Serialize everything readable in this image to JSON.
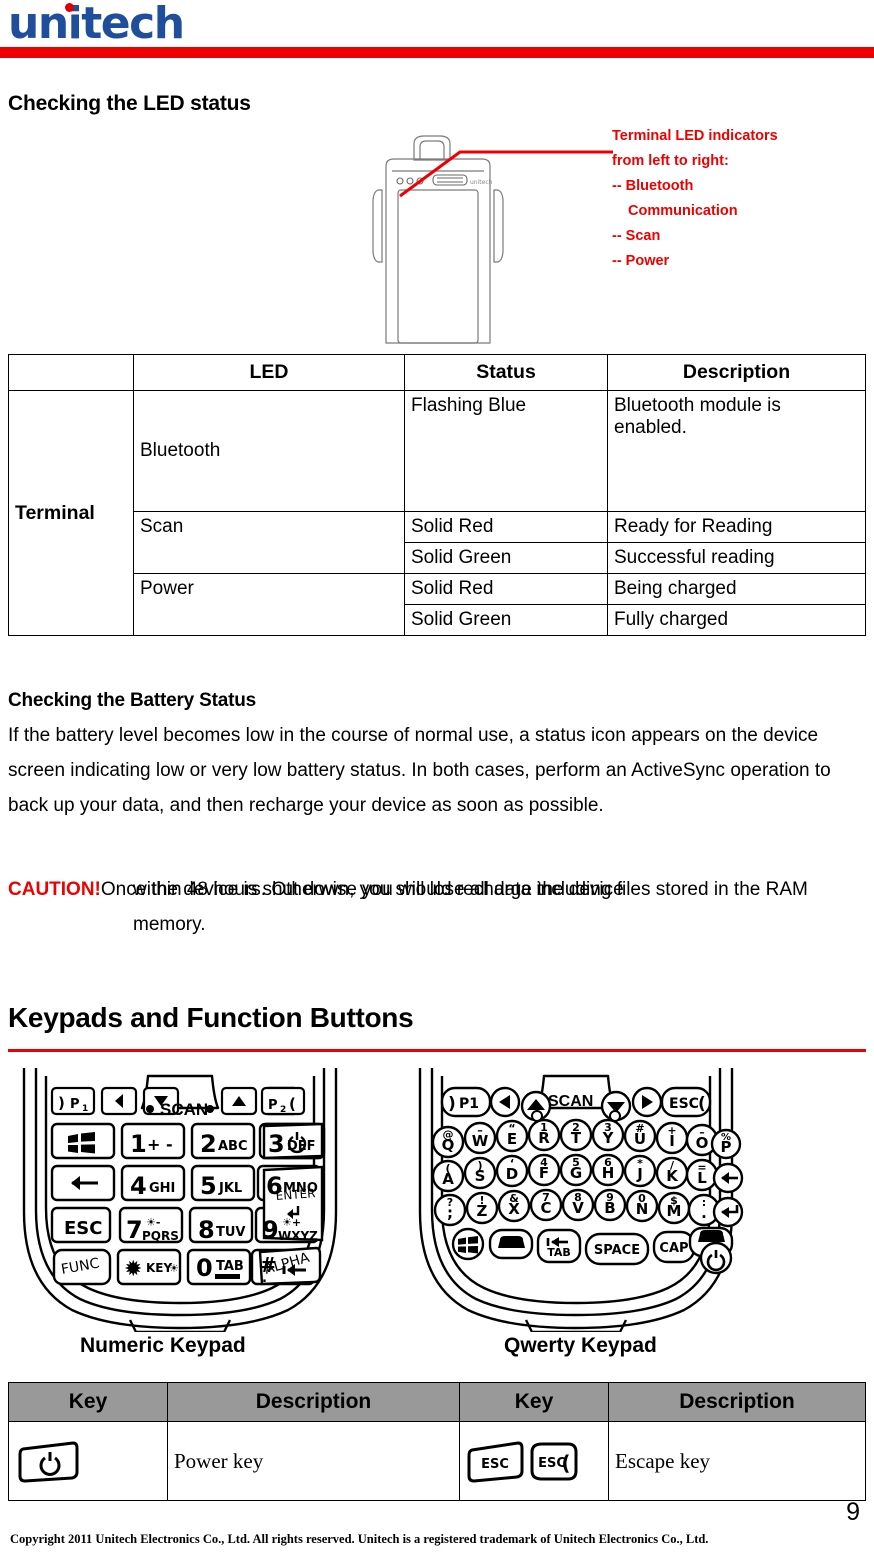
{
  "brand": {
    "logo_text": "unitech",
    "logo_color": "#1f4e9c",
    "accent_color": "#ee0000"
  },
  "headings": {
    "led_status": "Checking the LED status",
    "battery_status": "Checking the Battery Status",
    "keypads": "Keypads and Function Buttons"
  },
  "callout": {
    "line1": "Terminal LED indicators",
    "line2": "from left to right:",
    "line3": "-- Bluetooth",
    "line4": "Communication",
    "line5": "-- Scan",
    "line6": "-- Power"
  },
  "led_table": {
    "headers": [
      "",
      "LED",
      "Status",
      "Description"
    ],
    "group_label": "Terminal",
    "rows": [
      {
        "led": "Bluetooth",
        "status": "Flashing Blue",
        "description": "Bluetooth module is enabled."
      },
      {
        "led": "Scan",
        "status": "Solid Red",
        "description": "Ready for Reading"
      },
      {
        "led": "",
        "status": "Solid Green",
        "description": "Successful reading"
      },
      {
        "led": "Power",
        "status": "Solid Red",
        "description": "Being charged"
      },
      {
        "led": "",
        "status": "Solid Green",
        "description": "Fully charged"
      }
    ]
  },
  "battery_paragraph": "If the battery level becomes low in the course of normal use, a status icon appears on the device screen indicating low or very low battery status. In both cases, perform an ActiveSync operation to back up your data, and then recharge your device as soon as possible.",
  "caution": {
    "label": "CAUTION!",
    "first_line": "Once the device is shut down, you should recharge the device",
    "rest": "within 48 hours. Otherwise you will lose all data including files stored in the RAM memory."
  },
  "keypads": {
    "numeric_caption": "Numeric Keypad",
    "qwerty_caption": "Qwerty Keypad",
    "numeric": {
      "scan_label": "SCAN",
      "top_row": [
        "P1",
        "left",
        "up",
        "down",
        "right",
        "P2"
      ],
      "keys": [
        {
          "main": "",
          "sub": "",
          "icon": "windows-icon"
        },
        {
          "main": "1",
          "sub": "+ -"
        },
        {
          "main": "2",
          "sub": "ABC"
        },
        {
          "main": "3",
          "sub": "DEF"
        },
        {
          "main": "",
          "sub": "",
          "icon": "power-icon"
        },
        {
          "main": "",
          "sub": "",
          "icon": "backspace-icon"
        },
        {
          "main": "4",
          "sub": "GHI"
        },
        {
          "main": "5",
          "sub": "JKL"
        },
        {
          "main": "6",
          "sub": "MNO"
        },
        {
          "main": "ENTER",
          "sub": ""
        },
        {
          "main": "ESC",
          "sub": ""
        },
        {
          "main": "7",
          "sub": "PQRS",
          "sup": "☀-"
        },
        {
          "main": "8",
          "sub": "TUV"
        },
        {
          "main": "9",
          "sub": "WXYZ",
          "sup": "☀+"
        },
        {
          "main": "FUNC",
          "sub": ""
        },
        {
          "main": "✱",
          "sub": "KEY"
        },
        {
          "main": "0",
          "sub": "TAB"
        },
        {
          "main": "#",
          "sub": "."
        },
        {
          "main": "ALPHA",
          "sub": ""
        }
      ]
    },
    "qwerty": {
      "scan_label": "SCAN",
      "top_row": [
        "P1",
        "left",
        "up",
        "down",
        "right",
        "ESC"
      ],
      "rows": [
        [
          {
            "top": "@",
            "main": "Q"
          },
          {
            "top": "–",
            "main": "W"
          },
          {
            "top": "“",
            "main": "E"
          },
          {
            "top": "1",
            "main": "R"
          },
          {
            "top": "2",
            "main": "T"
          },
          {
            "top": "3",
            "main": "Y"
          },
          {
            "top": "#",
            "main": "U"
          },
          {
            "top": "+",
            "main": "I"
          },
          {
            "top": "–",
            "main": "O"
          },
          {
            "top": "%",
            "main": "P"
          }
        ],
        [
          {
            "top": "(",
            "main": "A"
          },
          {
            "top": ")",
            "main": "S"
          },
          {
            "top": "‘",
            "main": "D"
          },
          {
            "top": "4",
            "main": "F"
          },
          {
            "top": "5",
            "main": "G"
          },
          {
            "top": "6",
            "main": "H"
          },
          {
            "top": "*",
            "main": "J"
          },
          {
            "top": "/",
            "main": "K"
          },
          {
            "top": "=",
            "main": "L"
          },
          {
            "top": "",
            "main": "",
            "icon": "backspace-icon"
          }
        ],
        [
          {
            "top": "?",
            "main": ";"
          },
          {
            "top": "!",
            "main": "Z"
          },
          {
            "top": "&",
            "main": "X"
          },
          {
            "top": "7",
            "main": "C"
          },
          {
            "top": "8",
            "main": "V"
          },
          {
            "top": "9",
            "main": "B"
          },
          {
            "top": "0",
            "main": "N"
          },
          {
            "top": "$",
            "main": "M"
          },
          {
            "top": ":",
            "main": "."
          },
          {
            "top": "",
            "main": "",
            "icon": "enter-icon"
          }
        ],
        [
          {
            "main": "",
            "icon": "windows-icon"
          },
          {
            "main": "",
            "icon": "shift-icon"
          },
          {
            "main": "TAB",
            "icon": "tab-icon"
          },
          {
            "main": "SPACE"
          },
          {
            "main": "CAP"
          },
          {
            "main": "",
            "icon": "shift-icon"
          },
          {
            "main": "",
            "icon": "power-icon"
          }
        ]
      ]
    }
  },
  "key_table": {
    "headers": [
      "Key",
      "Description",
      "Key",
      "Description"
    ],
    "rows": [
      {
        "key_icon_left": "power-key-icon",
        "desc_left": "Power key",
        "key_icon_right": "escape-key-icon",
        "desc_right": "Escape key"
      }
    ]
  },
  "footer": {
    "page_number": "9",
    "copyright": "Copyright 2011 Unitech Electronics Co., Ltd. All rights reserved. Unitech is a registered trademark of Unitech Electronics Co., Ltd."
  }
}
